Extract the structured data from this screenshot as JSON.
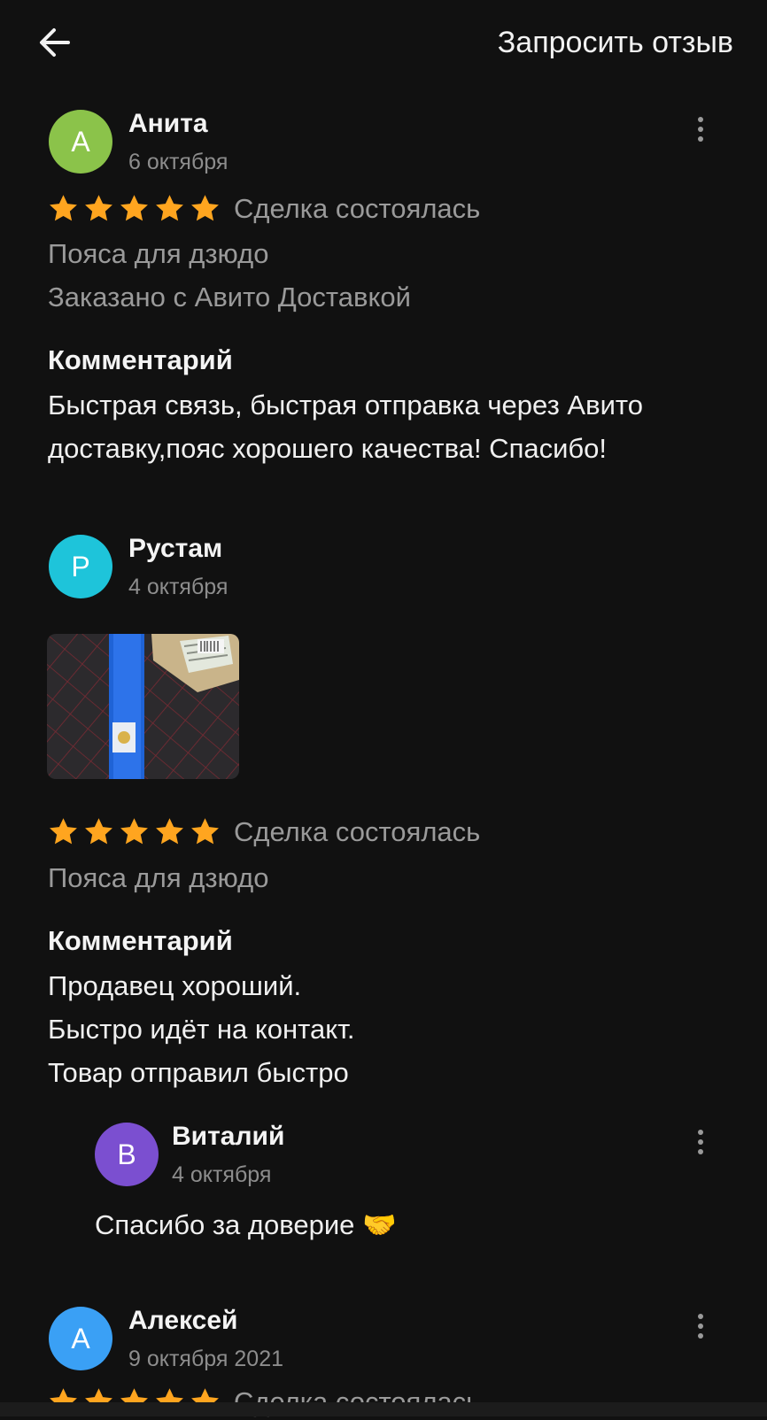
{
  "header": {
    "request_review_label": "Запросить отзыв"
  },
  "colors": {
    "background": "#111111",
    "star": "#FFA51F",
    "muted_text": "#9a9a9a",
    "avatar_anita": "#8BC34A",
    "avatar_rustam": "#1EC4DA",
    "avatar_vitaly": "#7B4FD0",
    "avatar_aleksey": "#3AA0F5"
  },
  "reviews": [
    {
      "author_initial": "А",
      "author_name": "Анита",
      "date": "6 октября",
      "rating": 5,
      "deal_status": "Сделка состоялась",
      "item": "Пояса для дзюдо",
      "delivery": "Заказано с Авито Доставкой",
      "comment_title": "Комментарий",
      "comment_lines": [
        "Быстрая связь, быстрая отправка через Авито",
        "доставку,пояс хорошего качества! Спасибо!"
      ]
    },
    {
      "author_initial": "Р",
      "author_name": "Рустам",
      "date": "4 октября",
      "rating": 5,
      "deal_status": "Сделка состоялась",
      "item": "Пояса для дзюдо",
      "comment_title": "Комментарий",
      "comment_lines": [
        "Продавец хороший.",
        "Быстро идёт на контакт.",
        "Товар отправил быстро"
      ],
      "reply": {
        "author_initial": "В",
        "author_name": "Виталий",
        "date": "4 октября",
        "text": "Спасибо за доверие 🤝"
      }
    },
    {
      "author_initial": "А",
      "author_name": "Алексей",
      "date": "9 октября 2021",
      "rating": 5,
      "deal_status": "Сделка состоялась"
    }
  ]
}
